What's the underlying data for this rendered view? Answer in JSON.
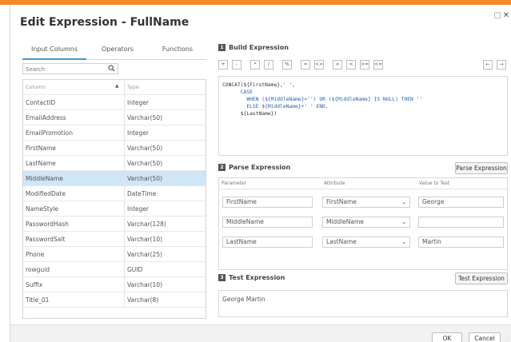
{
  "window": {
    "title": "Edit Expression - FullName",
    "minimize_glyph": "▢",
    "close_glyph": "✕",
    "accent_color": "#f08a2c"
  },
  "left": {
    "tabs": [
      {
        "label": "Input Columns",
        "active": true
      },
      {
        "label": "Operators",
        "active": false
      },
      {
        "label": "Functions",
        "active": false
      }
    ],
    "search_placeholder": "Search",
    "columns_header": {
      "name": "Column",
      "type": "Type"
    },
    "rows": [
      {
        "name": "ContactID",
        "type": "Integer",
        "selected": false
      },
      {
        "name": "EmailAddress",
        "type": "Varchar(50)",
        "selected": false
      },
      {
        "name": "EmailPromotion",
        "type": "Integer",
        "selected": false
      },
      {
        "name": "FirstName",
        "type": "Varchar(50)",
        "selected": false
      },
      {
        "name": "LastName",
        "type": "Varchar(50)",
        "selected": false
      },
      {
        "name": "MiddleName",
        "type": "Varchar(50)",
        "selected": true
      },
      {
        "name": "ModifiedDate",
        "type": "DateTime",
        "selected": false
      },
      {
        "name": "NameStyle",
        "type": "Integer",
        "selected": false
      },
      {
        "name": "PasswordHash",
        "type": "Varchar(128)",
        "selected": false
      },
      {
        "name": "PasswordSalt",
        "type": "Varchar(10)",
        "selected": false
      },
      {
        "name": "Phone",
        "type": "Varchar(25)",
        "selected": false
      },
      {
        "name": "rowguid",
        "type": "GUID",
        "selected": false
      },
      {
        "name": "Suffix",
        "type": "Varchar(10)",
        "selected": false
      },
      {
        "name": "Title_01",
        "type": "Varchar(8)",
        "selected": false
      }
    ]
  },
  "build": {
    "step": "1",
    "title": "Build Expression",
    "operators": [
      "+",
      "-",
      "*",
      "/",
      "%",
      "=",
      "<>",
      ">",
      "<",
      ">=",
      "<="
    ],
    "undo_glyph": "←",
    "redo_glyph": "→",
    "code_lines": [
      "CONCAT(${FirstName},' ',",
      "      CASE",
      "        WHEN (${MiddleName}='') OR (${MiddleName} IS NULL) THEN ''",
      "        ELSE ${MiddleName}+' ' END,",
      "      ${LastName})"
    ]
  },
  "parse": {
    "step": "2",
    "title": "Parse Expression",
    "button": "Parse Expression",
    "headers": {
      "parameter": "Parameter",
      "attribute": "Attribute",
      "value": "Value to Test"
    },
    "rows": [
      {
        "parameter": "FirstName",
        "attribute": "FirstName",
        "value": "George"
      },
      {
        "parameter": "MiddleName",
        "attribute": "MiddleName",
        "value": ""
      },
      {
        "parameter": "LastName",
        "attribute": "LastName",
        "value": "Martin"
      }
    ]
  },
  "test": {
    "step": "3",
    "title": "Test Expression",
    "button": "Test Expression",
    "result": "George Martin"
  },
  "footer": {
    "ok": "OK",
    "cancel": "Cancel"
  }
}
